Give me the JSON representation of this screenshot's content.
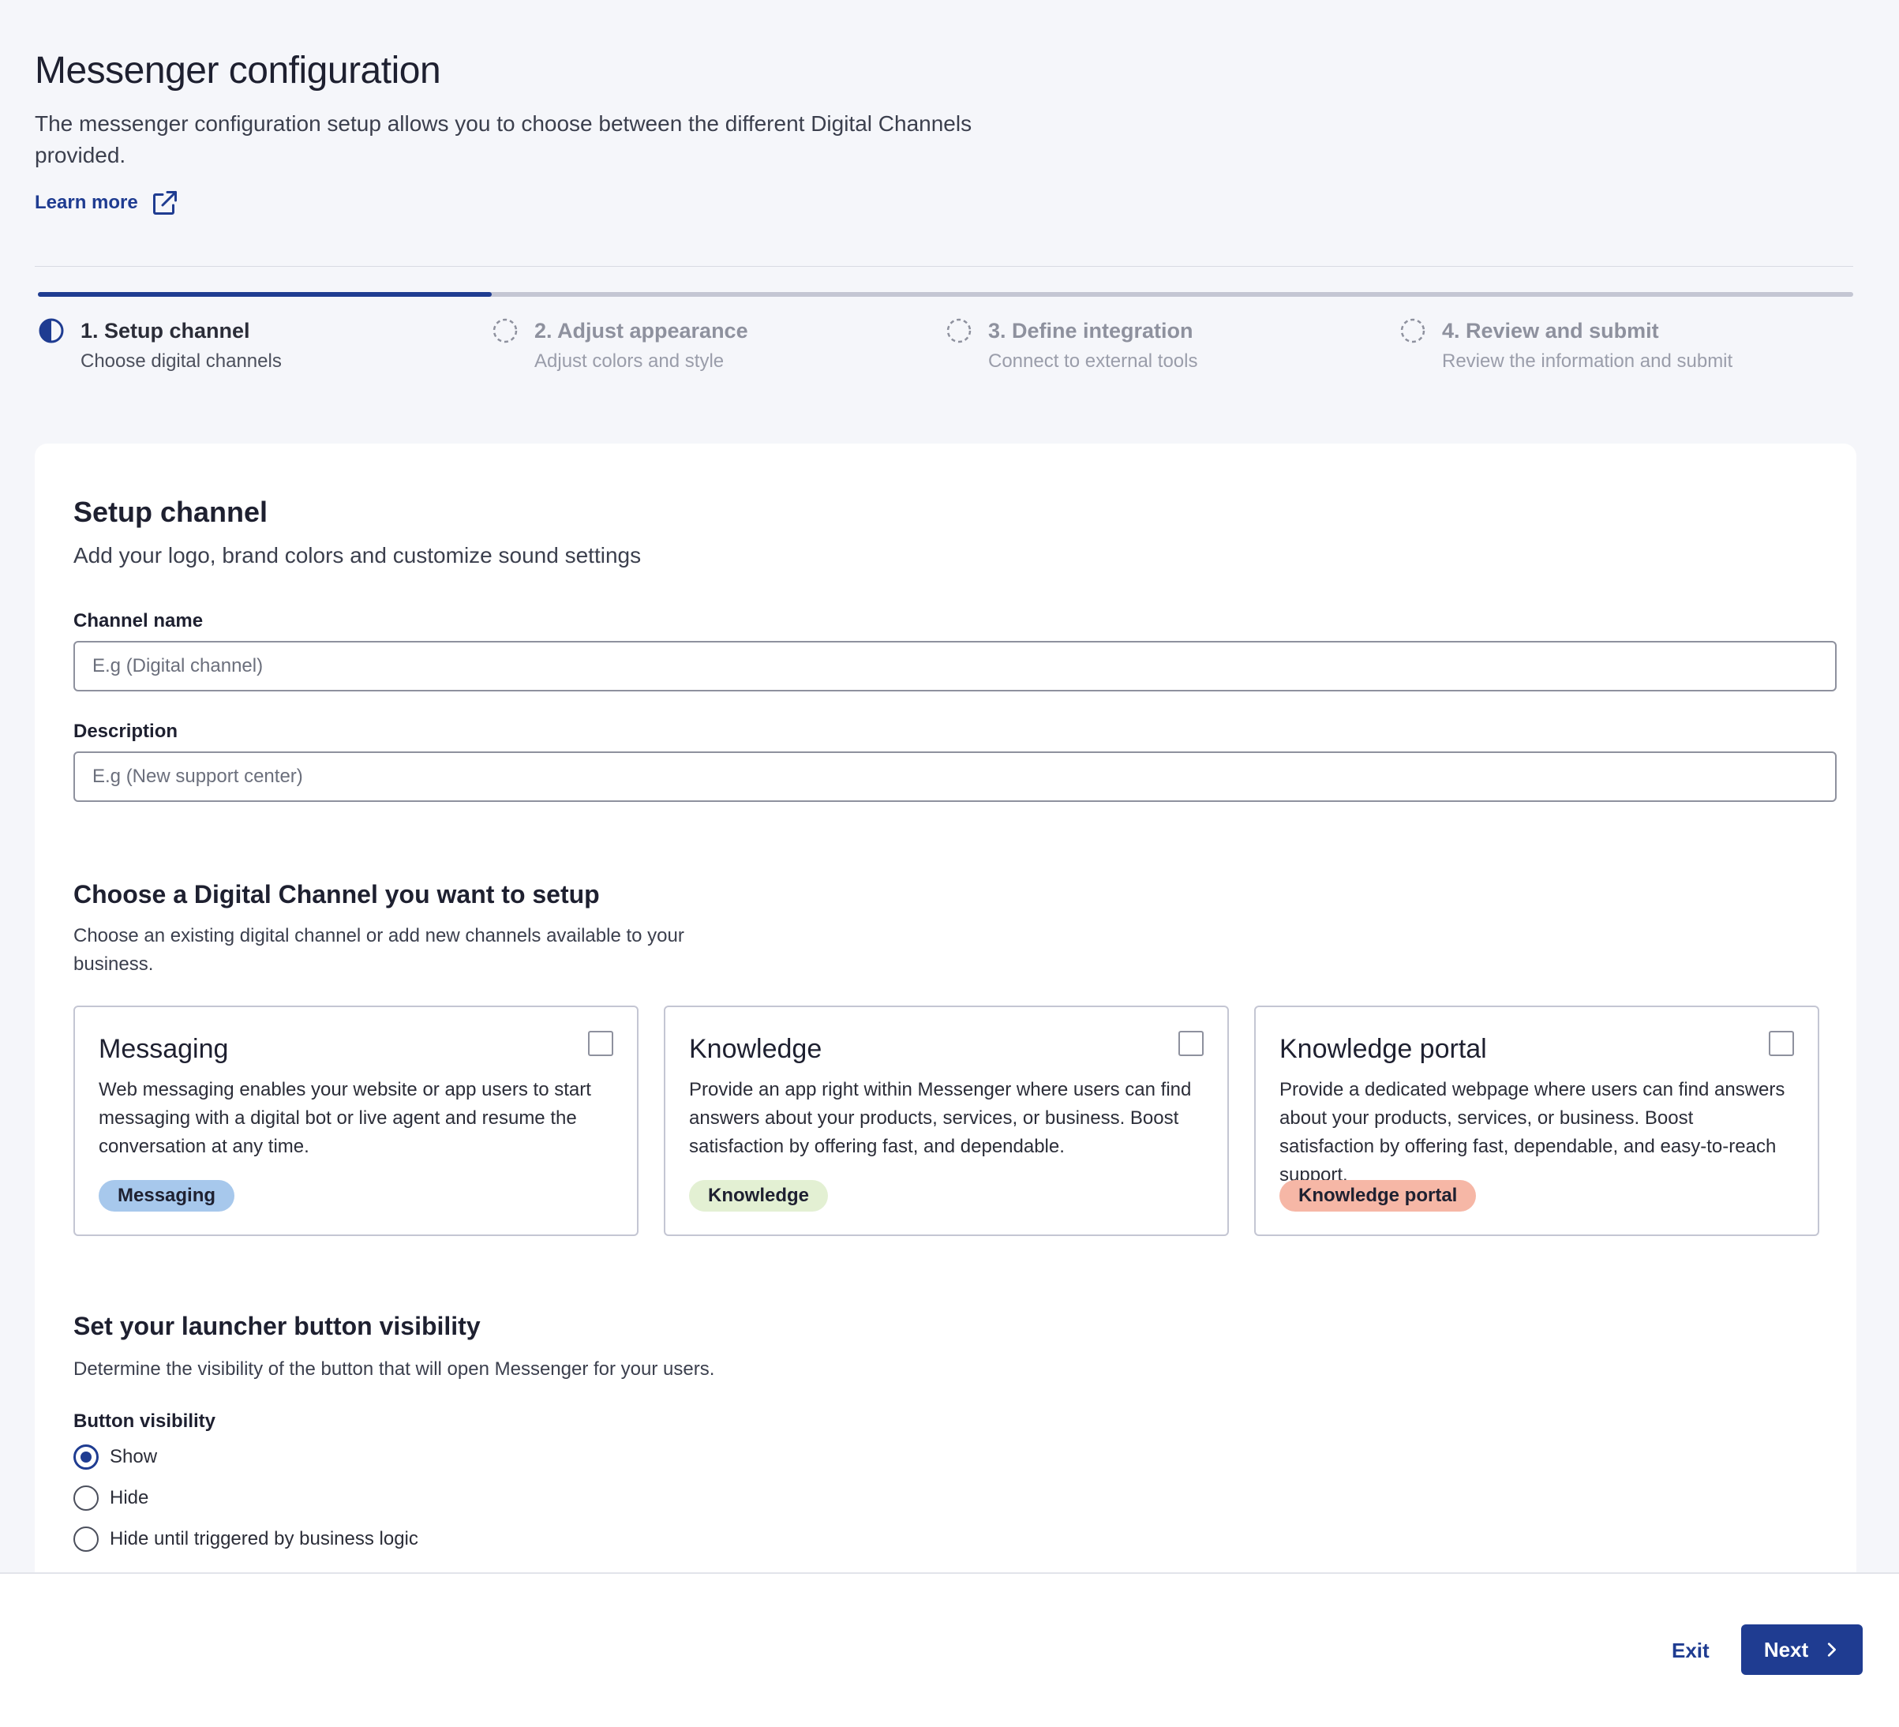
{
  "header": {
    "title": "Messenger configuration",
    "description": "The messenger configuration setup allows you to choose between the different Digital Channels provided.",
    "learn_more": "Learn more",
    "learn_more_icon": "external-link-icon"
  },
  "stepper": {
    "progress_fraction": 0.25,
    "steps": [
      {
        "title": "1. Setup channel",
        "subtitle": "Choose digital channels",
        "status": "in-progress"
      },
      {
        "title": "2. Adjust appearance",
        "subtitle": "Adjust colors and style",
        "status": "pending"
      },
      {
        "title": "3. Define integration",
        "subtitle": "Connect to external tools",
        "status": "pending"
      },
      {
        "title": "4. Review and submit",
        "subtitle": "Review the information and submit",
        "status": "pending"
      }
    ]
  },
  "setup": {
    "title": "Setup channel",
    "subtitle": "Add your logo, brand colors and customize sound settings",
    "channel_name_label": "Channel name",
    "channel_name_placeholder": "E.g (Digital channel)",
    "channel_name_value": "",
    "description_label": "Description",
    "description_placeholder": "E.g (New support center)",
    "description_value": ""
  },
  "channels": {
    "title": "Choose a Digital Channel you want to setup",
    "subtitle": "Choose an existing digital channel or add new channels available to your business.",
    "options": [
      {
        "title": "Messaging",
        "description": "Web messaging enables your website or app users to start messaging with a digital bot or live agent and resume the conversation at any time.",
        "badge": "Messaging",
        "badge_color": "#a7c8ec",
        "checked": false
      },
      {
        "title": "Knowledge",
        "description": "Provide an app right within Messenger where users can find answers about your products, services, or business. Boost satisfaction by offering fast, and dependable.",
        "badge": "Knowledge",
        "badge_color": "#e3f0d3",
        "checked": false
      },
      {
        "title": "Knowledge portal",
        "description": "Provide a dedicated webpage where users can find answers about your products, services, or business. Boost satisfaction by offering fast, dependable, and easy-to-reach support.",
        "badge": "Knowledge portal",
        "badge_color": "#f6b7a6",
        "checked": false
      }
    ]
  },
  "launcher": {
    "title": "Set your launcher button visibility",
    "subtitle": "Determine the visibility of the button that will open Messenger for your users.",
    "field_label": "Button visibility",
    "options": [
      "Show",
      "Hide",
      "Hide until triggered by business logic"
    ],
    "selected": "Show"
  },
  "footer": {
    "exit_label": "Exit",
    "next_label": "Next"
  },
  "colors": {
    "primary": "#1f3c91",
    "background": "#f5f6fa",
    "progress_track": "#c4c6d3"
  }
}
